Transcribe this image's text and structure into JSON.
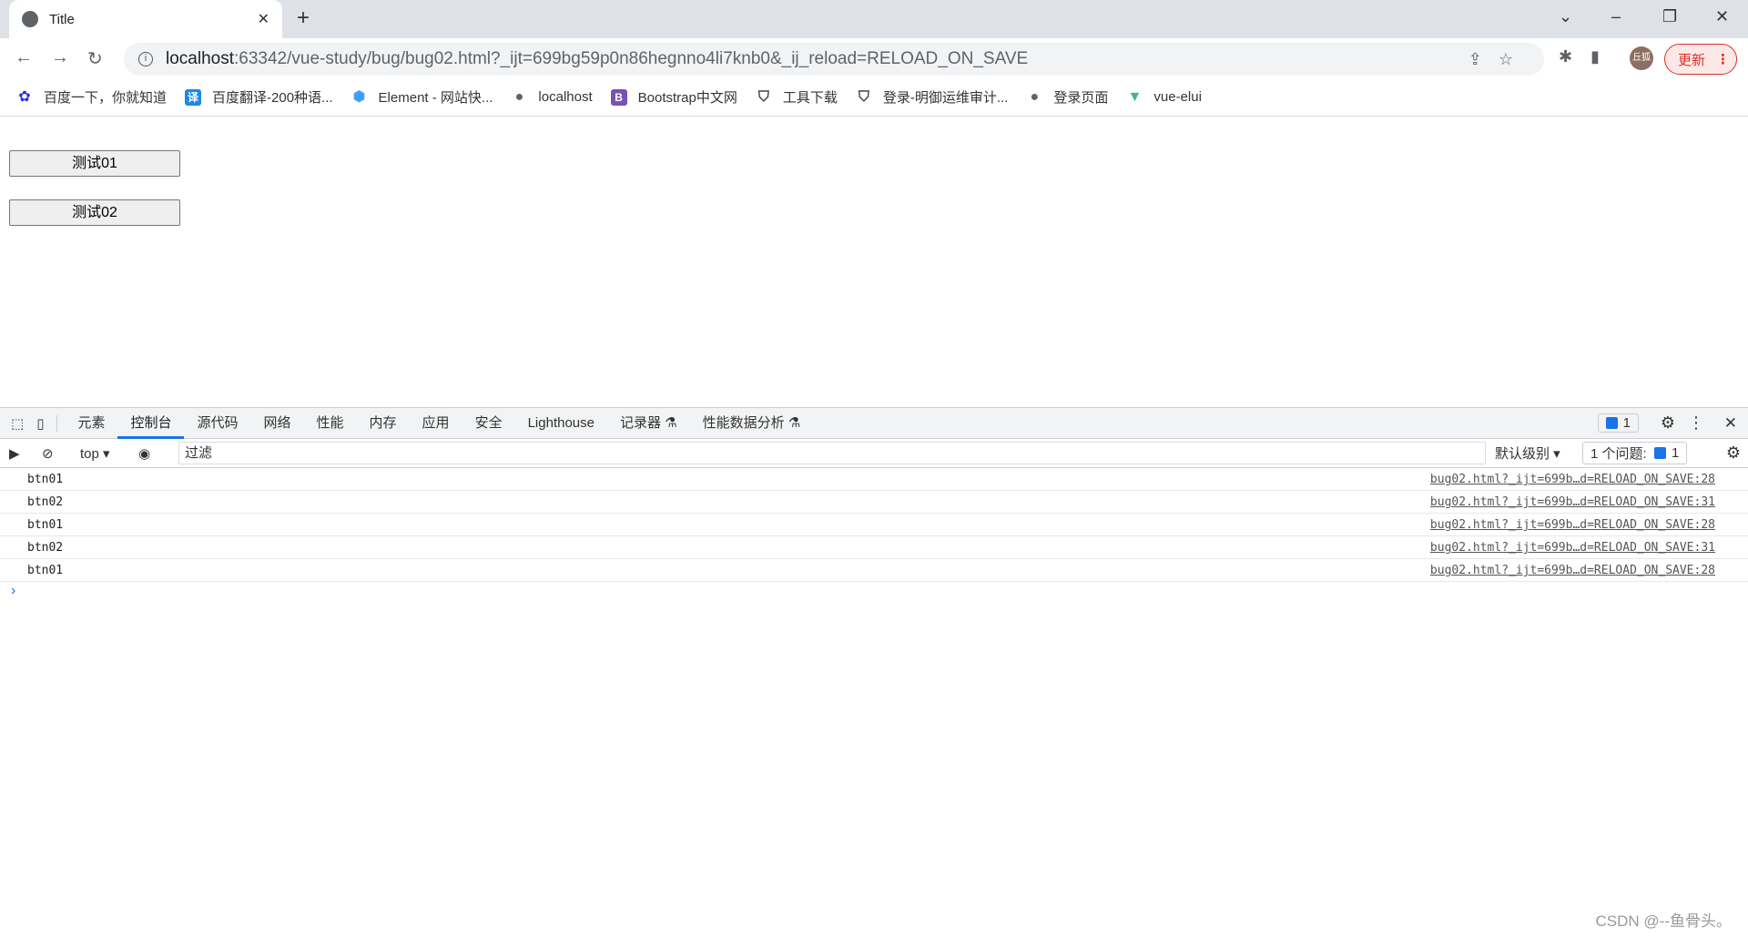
{
  "browser": {
    "tab_title": "Title",
    "url_host": "localhost",
    "url_rest": ":63342/vue-study/bug/bug02.html?_ijt=699bg59p0n86hegnno4li7knb0&_ij_reload=RELOAD_ON_SAVE",
    "avatar": "丘狐",
    "update_label": "更新"
  },
  "bookmarks": [
    {
      "label": "百度一下，你就知道",
      "icon": "paw-icon",
      "color": "#2932e1"
    },
    {
      "label": "百度翻译-200种语...",
      "icon": "translate-icon",
      "color": "#1e88e5"
    },
    {
      "label": "Element - 网站快...",
      "icon": "element-icon",
      "color": "#409eff"
    },
    {
      "label": "localhost",
      "icon": "globe-icon",
      "color": "#5f6368"
    },
    {
      "label": "Bootstrap中文网",
      "icon": "bootstrap-icon",
      "color": "#7952b3"
    },
    {
      "label": "工具下载",
      "icon": "shield-icon",
      "color": "#444"
    },
    {
      "label": "登录-明御运维审计...",
      "icon": "shield-icon",
      "color": "#444"
    },
    {
      "label": "登录页面",
      "icon": "globe-icon",
      "color": "#5f6368"
    },
    {
      "label": "vue-elui",
      "icon": "vue-icon",
      "color": "#41b883"
    }
  ],
  "page": {
    "buttons": [
      "测试01",
      "测试02"
    ]
  },
  "devtools": {
    "tabs": [
      "元素",
      "控制台",
      "源代码",
      "网络",
      "性能",
      "内存",
      "应用",
      "安全",
      "Lighthouse",
      "记录器 ⚗",
      "性能数据分析 ⚗"
    ],
    "active_tab": "控制台",
    "issues_badge": "1",
    "context": "top",
    "filter_placeholder": "过滤",
    "level": "默认级别",
    "issues_label": "1 个问题:",
    "issues_count": "1",
    "logs": [
      {
        "msg": "btn01",
        "src": "bug02.html?_ijt=699b…d=RELOAD_ON_SAVE:28"
      },
      {
        "msg": "btn02",
        "src": "bug02.html?_ijt=699b…d=RELOAD_ON_SAVE:31"
      },
      {
        "msg": "btn01",
        "src": "bug02.html?_ijt=699b…d=RELOAD_ON_SAVE:28"
      },
      {
        "msg": "btn02",
        "src": "bug02.html?_ijt=699b…d=RELOAD_ON_SAVE:31"
      },
      {
        "msg": "btn01",
        "src": "bug02.html?_ijt=699b…d=RELOAD_ON_SAVE:28"
      }
    ]
  },
  "watermark": "CSDN @--鱼骨头。"
}
